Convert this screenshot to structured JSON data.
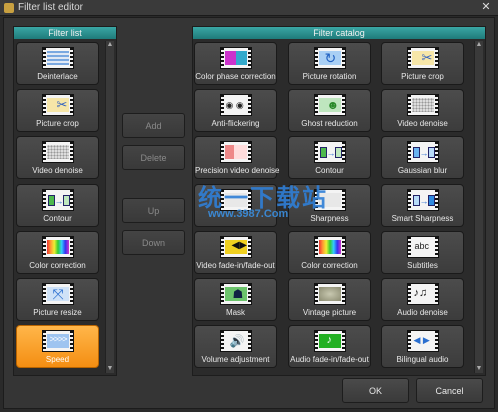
{
  "window": {
    "title": "Filter list editor",
    "close_glyph": "✕"
  },
  "filter_list": {
    "header": "Filter list",
    "items": [
      {
        "label": "Deinterlace",
        "icon": "deinterlace-icon"
      },
      {
        "label": "Picture crop",
        "icon": "crop-scissors-icon"
      },
      {
        "label": "Video denoise",
        "icon": "denoise-icon"
      },
      {
        "label": "Contour",
        "icon": "contour-icon"
      },
      {
        "label": "Color correction",
        "icon": "color-bars-icon"
      },
      {
        "label": "Picture resize",
        "icon": "resize-arrows-icon"
      },
      {
        "label": "Speed",
        "icon": "fast-forward-icon"
      }
    ]
  },
  "actions": {
    "add": "Add",
    "delete": "Delete",
    "up": "Up",
    "down": "Down"
  },
  "catalog": {
    "header": "Filter catalog",
    "items": [
      {
        "label": "Color phase correction",
        "icon": "color-phase-icon"
      },
      {
        "label": "Picture rotation",
        "icon": "rotation-icon"
      },
      {
        "label": "Picture crop",
        "icon": "crop-scissors-icon"
      },
      {
        "label": "Anti-flickering",
        "icon": "eye-icon"
      },
      {
        "label": "Ghost reduction",
        "icon": "ghost-icon"
      },
      {
        "label": "Video denoise",
        "icon": "denoise-icon"
      },
      {
        "label": "Precision video denoise",
        "icon": "precision-denoise-icon"
      },
      {
        "label": "Contour",
        "icon": "contour-icon"
      },
      {
        "label": "Gaussian blur",
        "icon": "blur-icon"
      },
      {
        "label": "",
        "icon": "sharpness-icon"
      },
      {
        "label": "Sharpness",
        "icon": "sharpness-icon"
      },
      {
        "label": "Smart Sharpness",
        "icon": "smart-sharpness-icon"
      },
      {
        "label": "Video fade-in/fade-out",
        "icon": "video-fade-icon"
      },
      {
        "label": "Color correction",
        "icon": "color-bars-icon"
      },
      {
        "label": "Subtitles",
        "icon": "subtitles-icon"
      },
      {
        "label": "Mask",
        "icon": "mask-icon"
      },
      {
        "label": "Vintage picture",
        "icon": "vintage-icon"
      },
      {
        "label": "Audio denoise",
        "icon": "music-notes-icon"
      },
      {
        "label": "Volume adjustment",
        "icon": "speaker-icon"
      },
      {
        "label": "Audio fade-in/fade-out",
        "icon": "audio-fade-icon"
      },
      {
        "label": "Bilingual audio",
        "icon": "bilingual-audio-icon"
      }
    ],
    "subtitles_sample": "abc"
  },
  "footer": {
    "ok": "OK",
    "cancel": "Cancel"
  },
  "watermark": {
    "line1": "统一下载站",
    "line2": "www.3987.Com"
  },
  "colors": {
    "accent": "#2a9896",
    "active_tile": "#f8a030"
  }
}
